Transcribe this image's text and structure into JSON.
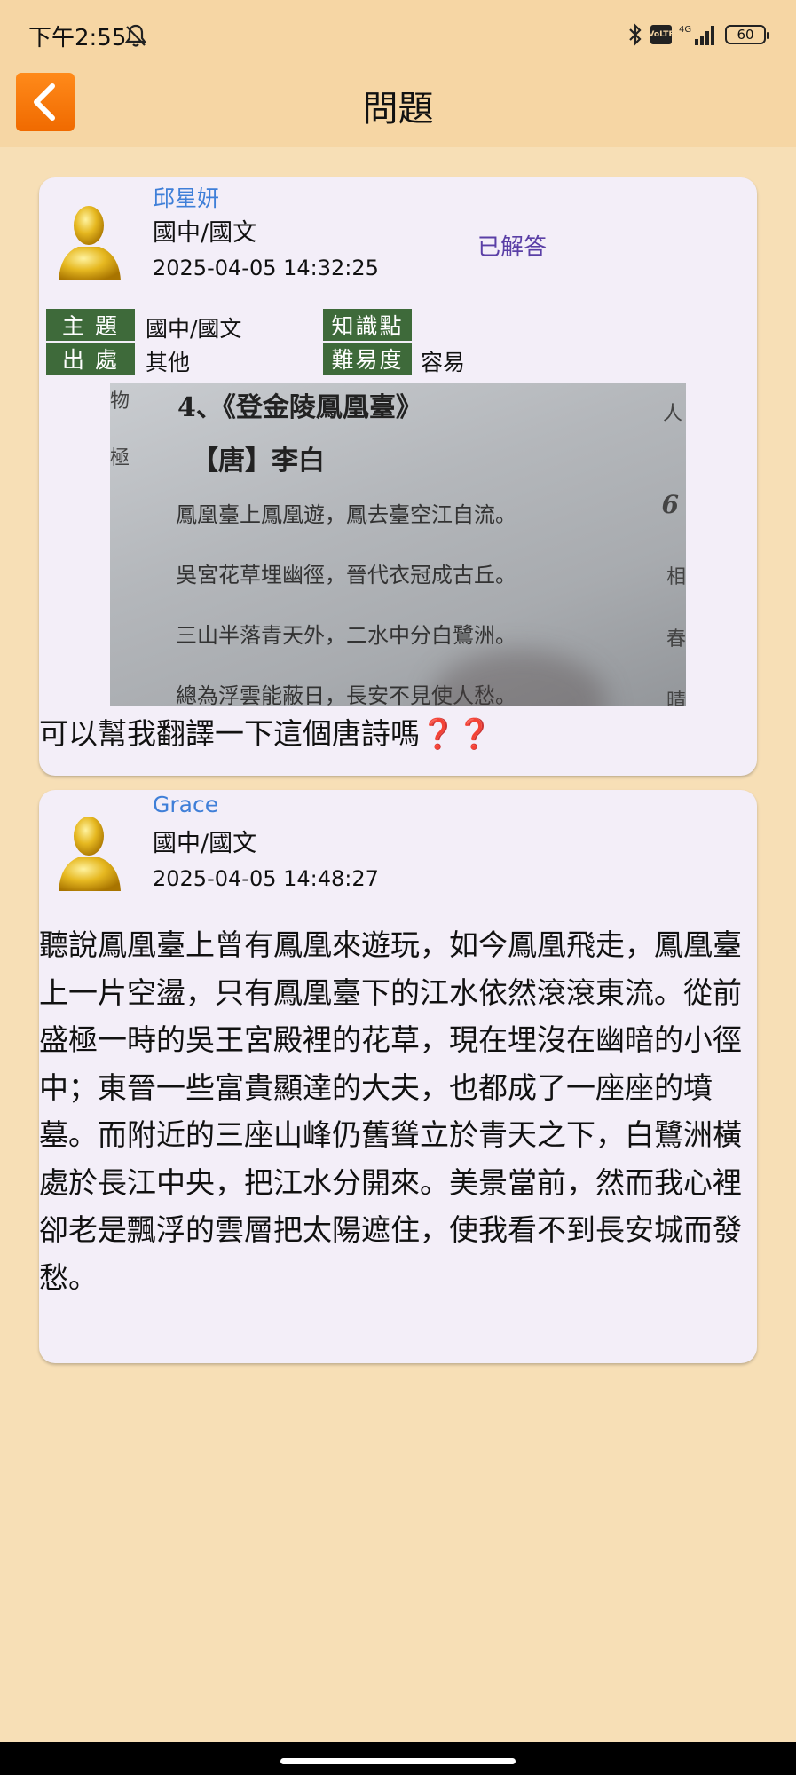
{
  "status_bar": {
    "time": "下午2:55",
    "icons": [
      "bell-off-icon",
      "bluetooth-icon",
      "volte-icon",
      "signal-4g-icon",
      "battery-icon"
    ],
    "network": "4G",
    "battery": "60"
  },
  "app_bar": {
    "title": "問題",
    "back_icon": "chevron-left-icon",
    "back_color": "#f57c00"
  },
  "question": {
    "user_name": "邱星妍",
    "subject": "國中/國文",
    "time": "2025-04-05 14:32:25",
    "status": "已解答",
    "meta": {
      "topic_label": "主 題",
      "topic_value": "國中/國文",
      "knowledge_label": "知識點",
      "knowledge_value": "",
      "source_label": "出 處",
      "source_value": "其他",
      "difficulty_label": "難易度",
      "difficulty_value": "容易"
    },
    "photo": {
      "title": "4、《登金陵鳳凰臺》",
      "author": "【唐】李白",
      "lines": [
        "鳳凰臺上鳳凰遊，鳳去臺空江自流。",
        "吳宮花草埋幽徑，晉代衣冠成古丘。",
        "三山半落青天外，二水中分白鷺洲。",
        "總為浮雲能蔽日，長安不見使人愁。"
      ],
      "edge_left": [
        "物",
        "極"
      ],
      "edge_right": [
        "人",
        "6",
        "相",
        "春",
        "晴"
      ]
    },
    "text": "可以幫我翻譯一下這個唐詩嗎",
    "emoji": "❓❓"
  },
  "answer": {
    "user_name": "Grace",
    "subject": "國中/國文",
    "time": "2025-04-05 14:48:27",
    "text": "聽說鳳凰臺上曾有鳳凰來遊玩，如今鳳凰飛走，鳳凰臺上一片空盪，只有鳳凰臺下的江水依然滾滾東流。從前盛極一時的吳王宮殿裡的花草，現在埋沒在幽暗的小徑中；東晉一些富貴顯達的大夫，也都成了一座座的墳墓。而附近的三座山峰仍舊聳立於青天之下，白鷺洲橫處於長江中央，把江水分開來。美景當前，然而我心裡卻老是飄浮的雲層把太陽遮住，使我看不到長安城而發愁。"
  },
  "colors": {
    "background": "#f7dfb6",
    "header": "#f6d6a4",
    "card": "#f3eef8",
    "name": "#3f7fd8",
    "status": "#5a3fa6",
    "meta_label": "#3e6a3a"
  }
}
